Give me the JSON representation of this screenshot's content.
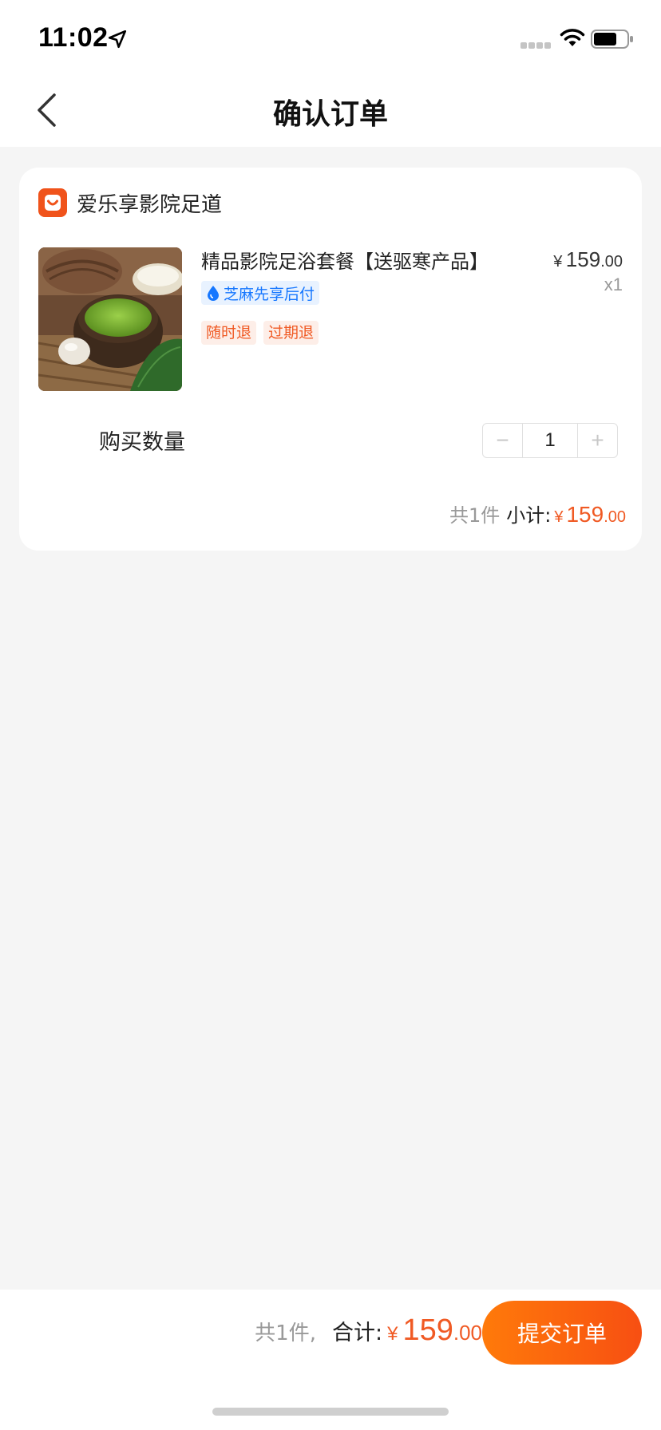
{
  "status_bar": {
    "time": "11:02"
  },
  "nav": {
    "title": "确认订单"
  },
  "shop": {
    "name": "爱乐享影院足道"
  },
  "product": {
    "title": "精品影院足浴套餐【送驱寒产品】",
    "payment_badge": "芝麻先享后付",
    "tags": [
      "随时退",
      "过期退"
    ],
    "price_currency": "¥",
    "price_int": "159",
    "price_dec": ".00",
    "quantity_text": "x1"
  },
  "quantity": {
    "label": "购买数量",
    "value": "1",
    "minus": "−",
    "plus": "+"
  },
  "subtotal": {
    "count_text": "共1件",
    "label": "小计:",
    "currency": "¥",
    "amount_int": "159",
    "amount_dec": ".00"
  },
  "footer": {
    "count_text": "共1件,",
    "label": "合计:",
    "currency": "¥",
    "amount_int": "159",
    "amount_dec": ".00",
    "submit_label": "提交订单"
  },
  "colors": {
    "accent": "#f05a24",
    "badge_blue": "#1677ff"
  }
}
